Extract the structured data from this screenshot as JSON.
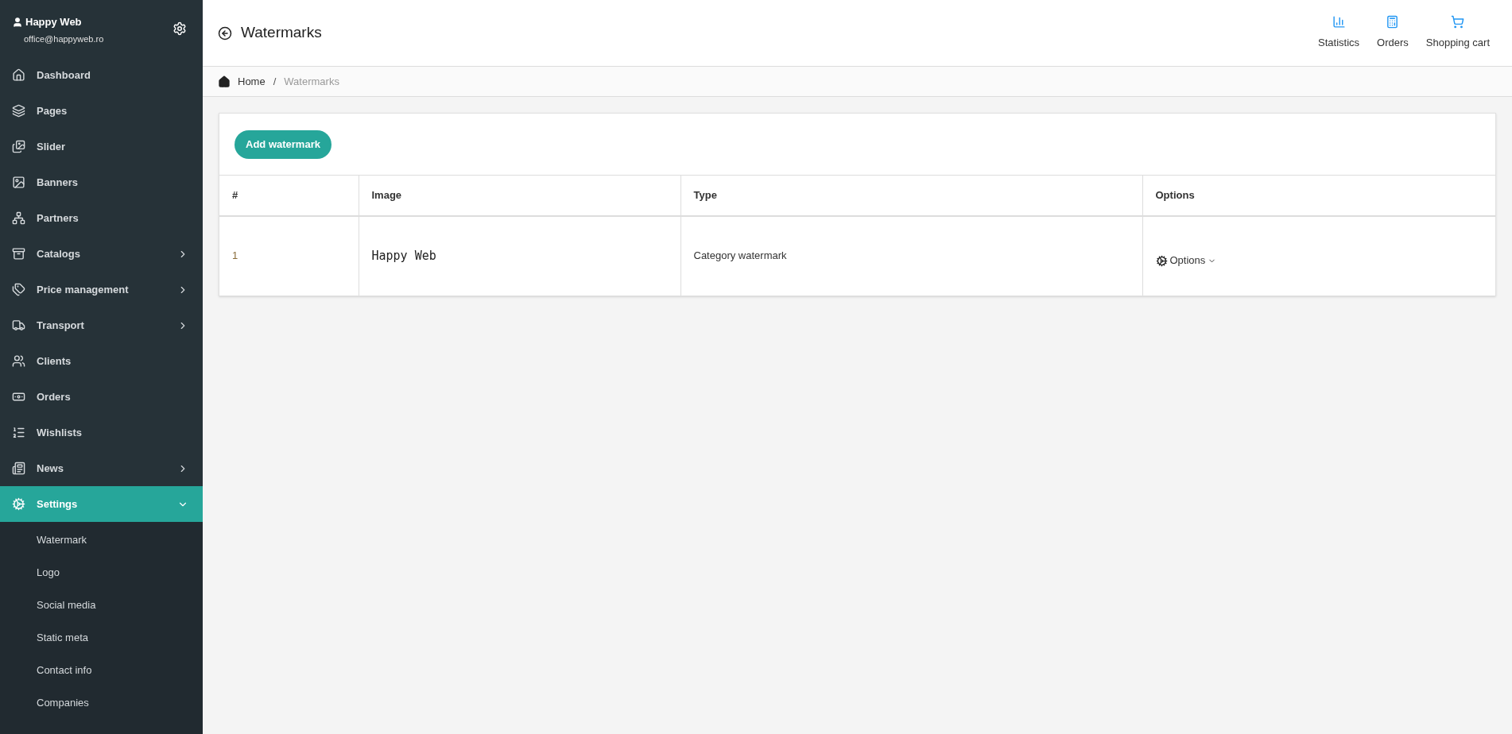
{
  "user": {
    "name": "Happy Web",
    "email": "office@happyweb.ro"
  },
  "sidebar": {
    "items": [
      {
        "label": "Dashboard",
        "kind": "link",
        "selected": false
      },
      {
        "label": "Pages",
        "kind": "link",
        "selected": false
      },
      {
        "label": "Slider",
        "kind": "link",
        "selected": false
      },
      {
        "label": "Banners",
        "kind": "link",
        "selected": false
      },
      {
        "label": "Partners",
        "kind": "link",
        "selected": false
      },
      {
        "label": "Catalogs",
        "kind": "group",
        "selected": false,
        "expanded": false
      },
      {
        "label": "Price management",
        "kind": "group",
        "selected": false,
        "expanded": false
      },
      {
        "label": "Transport",
        "kind": "group",
        "selected": false,
        "expanded": false
      },
      {
        "label": "Clients",
        "kind": "link",
        "selected": false
      },
      {
        "label": "Orders",
        "kind": "link",
        "selected": false
      },
      {
        "label": "Wishlists",
        "kind": "link",
        "selected": false
      },
      {
        "label": "News",
        "kind": "group",
        "selected": false,
        "expanded": false
      },
      {
        "label": "Settings",
        "kind": "group",
        "selected": true,
        "expanded": true,
        "children": [
          {
            "label": "Watermark"
          },
          {
            "label": "Logo"
          },
          {
            "label": "Social media"
          },
          {
            "label": "Static meta"
          },
          {
            "label": "Contact info"
          },
          {
            "label": "Companies"
          }
        ]
      }
    ]
  },
  "page": {
    "title": "Watermarks"
  },
  "toolbar": [
    {
      "label": "Statistics"
    },
    {
      "label": "Orders"
    },
    {
      "label": "Shopping cart"
    }
  ],
  "breadcrumb": [
    {
      "label": "Home"
    },
    {
      "label": "Watermarks"
    }
  ],
  "breadcrumb_separator": "/",
  "add_button": "Add watermark",
  "table": {
    "columns": [
      "#",
      "Image",
      "Type",
      "Options"
    ],
    "rows": [
      {
        "number": "1",
        "image": "Happy Web",
        "type": "Category watermark",
        "options": "Options"
      }
    ]
  }
}
